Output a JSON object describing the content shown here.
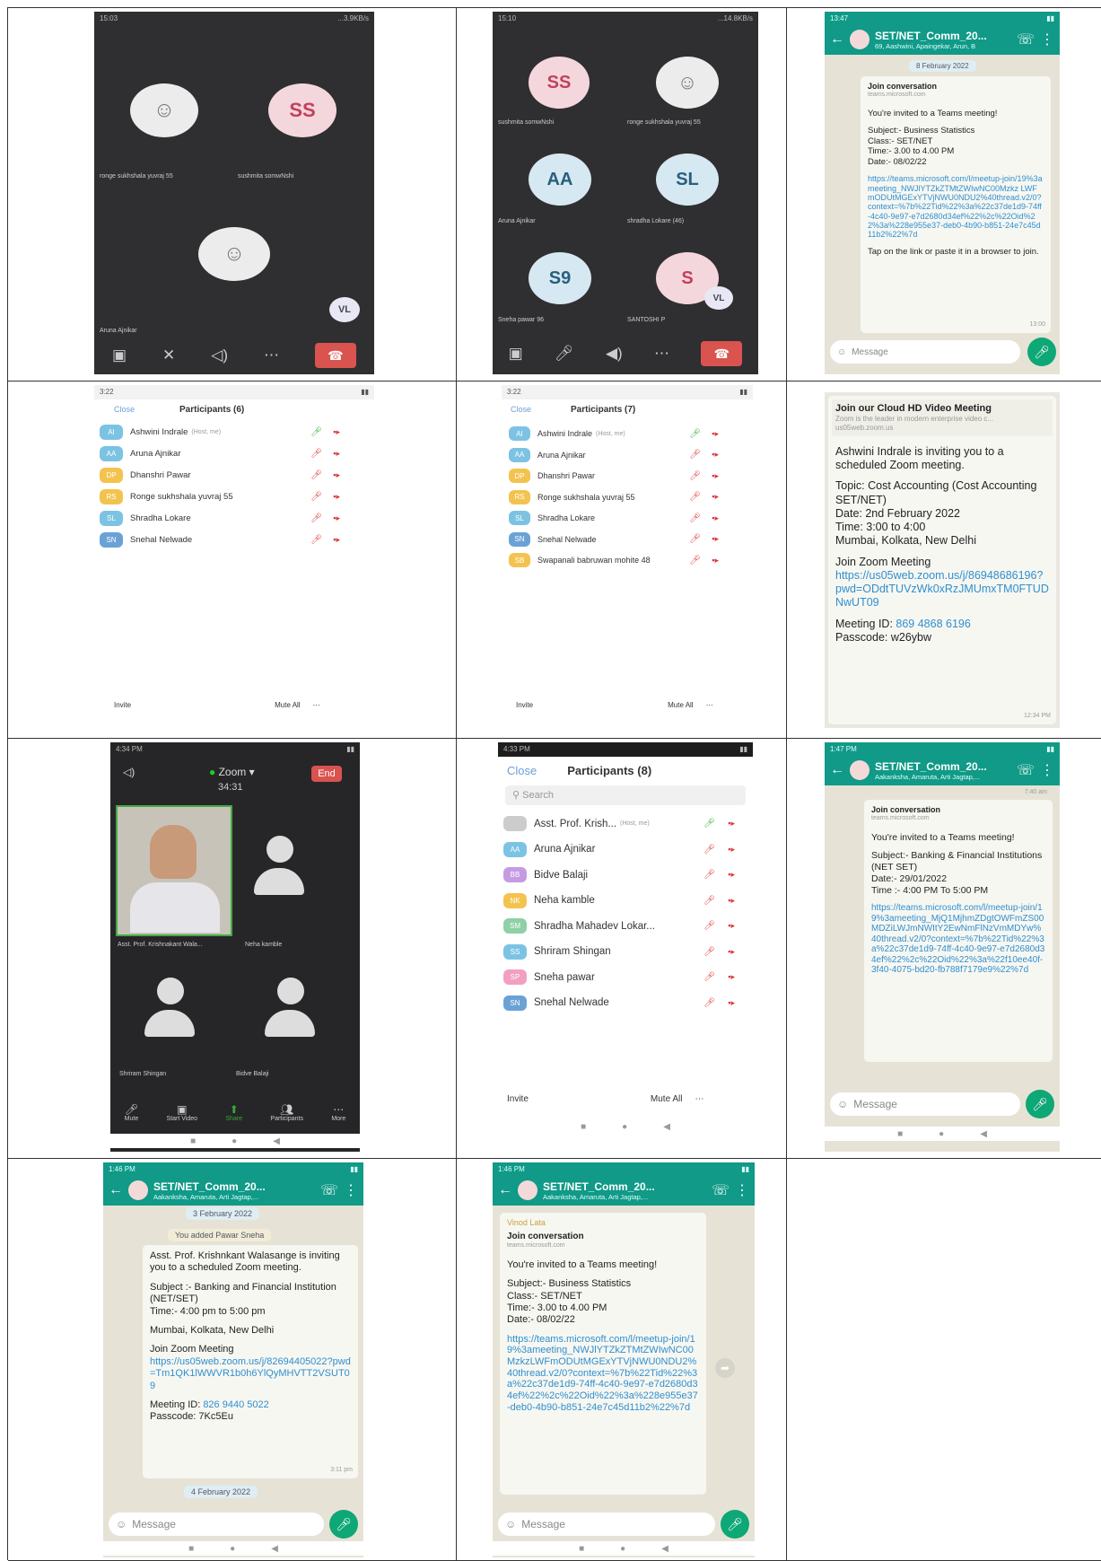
{
  "cells": {
    "c1": {
      "status_time": "15:03",
      "status_right": "...3.9KB/s",
      "participants": [
        {
          "label": "ronge sukhshala yuvraj 55"
        },
        {
          "label": "sushmita somwNshi",
          "initials": "SS"
        },
        {
          "label": "Aruna Ajnikar"
        }
      ],
      "vl": "VL"
    },
    "c2": {
      "status_time": "15:10",
      "status_right": "...14.8KB/s",
      "tiles": [
        {
          "initials": "SS",
          "label": "sushmita somwNshi"
        },
        {
          "initials": "",
          "label": "ronge sukhshala yuvraj 55"
        },
        {
          "initials": "AA",
          "label": "Aruna Ajnikar"
        },
        {
          "initials": "SL",
          "label": "shradha Lokare (46)"
        },
        {
          "initials": "S9",
          "label": "Sneha pawar 96"
        },
        {
          "initials": "S",
          "label": "SANTOSHI P"
        }
      ],
      "vl": "VL"
    },
    "c3": {
      "status_time": "13:47",
      "title": "SET/NET_Comm_20...",
      "subtitle": "69, Aashwini, Apaingekar, Arun, B",
      "date_pill": "8 February 2022",
      "join": "Join conversation",
      "join_sub": "teams.microsoft.com",
      "invite": "You're invited to a Teams meeting!",
      "subject": "Subject:- Business Statistics",
      "class": "Class:- SET/NET",
      "time": "Time:- 3.00 to 4.00 PM",
      "date": "Date:- 08/02/22",
      "link": "https://teams.microsoft.com/l/meetup-join/19%3ameeting_NWJlYTZkZTMtZWIwNC00Mzkz LWFmODUtMGExYTVjNWU0NDU2%40thread.v2/0?context=%7b%22Tid%22%3a%22c37de1d9-74ff-4c40-9e97-e7d2680d34ef%22%2c%22Oid%22%3a%228e955e37-deb0-4b90-b851-24e7c45d11b2%22%7d",
      "tap": "Tap on the link or paste it in a browser to join.",
      "ts": "13:00",
      "message": "Message"
    },
    "c4": {
      "status_time": "3:22",
      "close": "Close",
      "header": "Participants (6)",
      "rows": [
        {
          "init": "AI",
          "name": "Ashwini Indrale",
          "host": "(Host, me)",
          "color": "#7cc3e3"
        },
        {
          "init": "AA",
          "name": "Aruna Ajnikar",
          "host": "",
          "color": "#7cc3e3"
        },
        {
          "init": "DP",
          "name": "Dhanshri Pawar",
          "host": "",
          "color": "#f3c34f"
        },
        {
          "init": "RS",
          "name": "Ronge sukhshala yuvraj 55",
          "host": "",
          "color": "#f3c34f"
        },
        {
          "init": "SL",
          "name": "Shradha Lokare",
          "host": "",
          "color": "#7cc3e3"
        },
        {
          "init": "SN",
          "name": "Snehal Nelwade",
          "host": "",
          "color": "#6aa2d6"
        }
      ],
      "invite": "Invite",
      "mute": "Mute All"
    },
    "c5": {
      "status_time": "3:22",
      "close": "Close",
      "header": "Participants (7)",
      "rows": [
        {
          "init": "AI",
          "name": "Ashwini Indrale",
          "host": "(Host, me)",
          "color": "#7cc3e3"
        },
        {
          "init": "AA",
          "name": "Aruna Ajnikar",
          "host": "",
          "color": "#7cc3e3"
        },
        {
          "init": "DP",
          "name": "Dhanshri Pawar",
          "host": "",
          "color": "#f3c34f"
        },
        {
          "init": "RS",
          "name": "Ronge sukhshala yuvraj 55",
          "host": "",
          "color": "#f3c34f"
        },
        {
          "init": "SL",
          "name": "Shradha Lokare",
          "host": "",
          "color": "#7cc3e3"
        },
        {
          "init": "SN",
          "name": "Snehal Nelwade",
          "host": "",
          "color": "#6aa2d6"
        },
        {
          "init": "SB",
          "name": "Swapanali babruwan mohite 48",
          "host": "",
          "color": "#f3c34f"
        }
      ],
      "invite": "Invite",
      "mute": "Mute All"
    },
    "c6": {
      "title": "Join our Cloud HD Video Meeting",
      "desc": "Zoom is the leader in modern enterprise video c...",
      "domain": "us05web.zoom.us",
      "l1": "Ashwini Indrale is inviting you to a scheduled Zoom meeting.",
      "l2": "Topic: Cost Accounting (Cost Accounting SET/NET)",
      "l3": "Date: 2nd February 2022",
      "l4": "Time: 3:00 to 4:00",
      "l5": "Mumbai, Kolkata, New Delhi",
      "l6": "Join Zoom Meeting",
      "link": "https://us05web.zoom.us/j/86948686196?pwd=ODdtTUVzWk0xRzJMUmxTM0FTUDNwUT09",
      "mid_label": "Meeting ID:",
      "mid": "869 4868 6196",
      "pass": "Passcode: w26ybw",
      "ts": "12:34 PM"
    },
    "c7": {
      "status_time": "4:34 PM",
      "app": "Zoom",
      "timer": "34:31",
      "end": "End",
      "tiles": [
        {
          "label": "Asst. Prof. Krishnakant Wala..."
        },
        {
          "label": "Neha kamble"
        },
        {
          "label": "Shriram Shingan"
        },
        {
          "label": "Bidve Balaji"
        }
      ],
      "ctrl": [
        "Mute",
        "Start Video",
        "Share",
        "Participants",
        "More"
      ]
    },
    "c8": {
      "status_time": "4:33 PM",
      "close": "Close",
      "header": "Participants (8)",
      "search": "Search",
      "rows": [
        {
          "init": "",
          "name": "Asst. Prof. Krish...",
          "host": "(Host, me)",
          "color": "#ccc"
        },
        {
          "init": "AA",
          "name": "Aruna Ajnikar",
          "host": "",
          "color": "#7cc3e3"
        },
        {
          "init": "BB",
          "name": "Bidve Balaji",
          "host": "",
          "color": "#c49be3"
        },
        {
          "init": "NK",
          "name": "Neha kamble",
          "host": "",
          "color": "#f3c34f"
        },
        {
          "init": "SM",
          "name": "Shradha Mahadev Lokar...",
          "host": "",
          "color": "#8fd0a6"
        },
        {
          "init": "SS",
          "name": "Shriram Shingan",
          "host": "",
          "color": "#7cc3e3"
        },
        {
          "init": "SP",
          "name": "Sneha pawar",
          "host": "",
          "color": "#f29fc2"
        },
        {
          "init": "SN",
          "name": "Snehal Nelwade",
          "host": "",
          "color": "#6aa2d6"
        }
      ],
      "invite": "Invite",
      "mute": "Mute All"
    },
    "c9": {
      "status_time": "1:47 PM",
      "title": "SET/NET_Comm_20...",
      "subtitle": "Aakanksha, Amaruta, Arti Jagtap,...",
      "top_ts": "7:40 am",
      "join": "Join conversation",
      "join_sub": "teams.microsoft.com",
      "invite": "You're invited to a Teams meeting!",
      "subject": "Subject:- Banking & Financial Institutions (NET SET)",
      "date": "Date:- 29/01/2022",
      "time": "Time :- 4:00 PM To 5:00 PM",
      "link": "https://teams.microsoft.com/l/meetup-join/19%3ameeting_MjQ1MjhmZDgtOWFmZS00MDZiLWJmNWItY2EwNmFlNzVmMDYw%40thread.v2/0?context=%7b%22Tid%22%3a%22c37de1d9-74ff-4c40-9e97-e7d2680d34ef%22%2c%22Oid%22%3a%22f10ee40f-3f40-4075-bd20-fb788f7179e9%22%7d",
      "message": "Message"
    },
    "c10": {
      "status_time": "1:46 PM",
      "title": "SET/NET_Comm_20...",
      "subtitle": "Aakanksha, Amaruta, Arti Jagtap,...",
      "date_pill": "3 February 2022",
      "added": "You added Pawar Sneha",
      "l1": "Asst. Prof. Krishnkant Walasange is inviting you to a scheduled Zoom meeting.",
      "l2": "Subject :- Banking and Financial Institution (NET/SET)",
      "l3": "Time:- 4:00 pm to 5:00 pm",
      "l4": "Mumbai, Kolkata, New Delhi",
      "l5": "Join Zoom Meeting",
      "link": "https://us05web.zoom.us/j/82694405022?pwd=Tm1QK1lWWVR1b0h6YlQyMHVTT2VSUT09",
      "mid_label": "Meeting ID:",
      "mid": "826 9440 5022",
      "pass": "Passcode: 7Kc5Eu",
      "ts": "3:11 pm",
      "date_pill2": "4 February 2022",
      "message": "Message"
    },
    "c11": {
      "status_time": "1:46 PM",
      "title": "SET/NET_Comm_20...",
      "subtitle": "Aakanksha, Amaruta, Arti Jagtap,...",
      "sender": "Vinod Lata",
      "join": "Join conversation",
      "join_sub": "teams.microsoft.com",
      "invite": "You're invited to a Teams meeting!",
      "subject": "Subject:- Business Statistics",
      "class": "Class:- SET/NET",
      "time": "Time:- 3.00 to 4.00 PM",
      "date": "Date:- 08/02/22",
      "link": "https://teams.microsoft.com/l/meetup-join/19%3ameeting_NWJlYTZkZTMtZWIwNC00MzkzLWFmODUtMGExYTVjNWU0NDU2%40thread.v2/0?context=%7b%22Tid%22%3a%22c37de1d9-74ff-4c40-9e97-e7d2680d34ef%22%2c%22Oid%22%3a%228e955e37-deb0-4b90-b851-24e7c45d11b2%22%7d",
      "message": "Message"
    }
  }
}
